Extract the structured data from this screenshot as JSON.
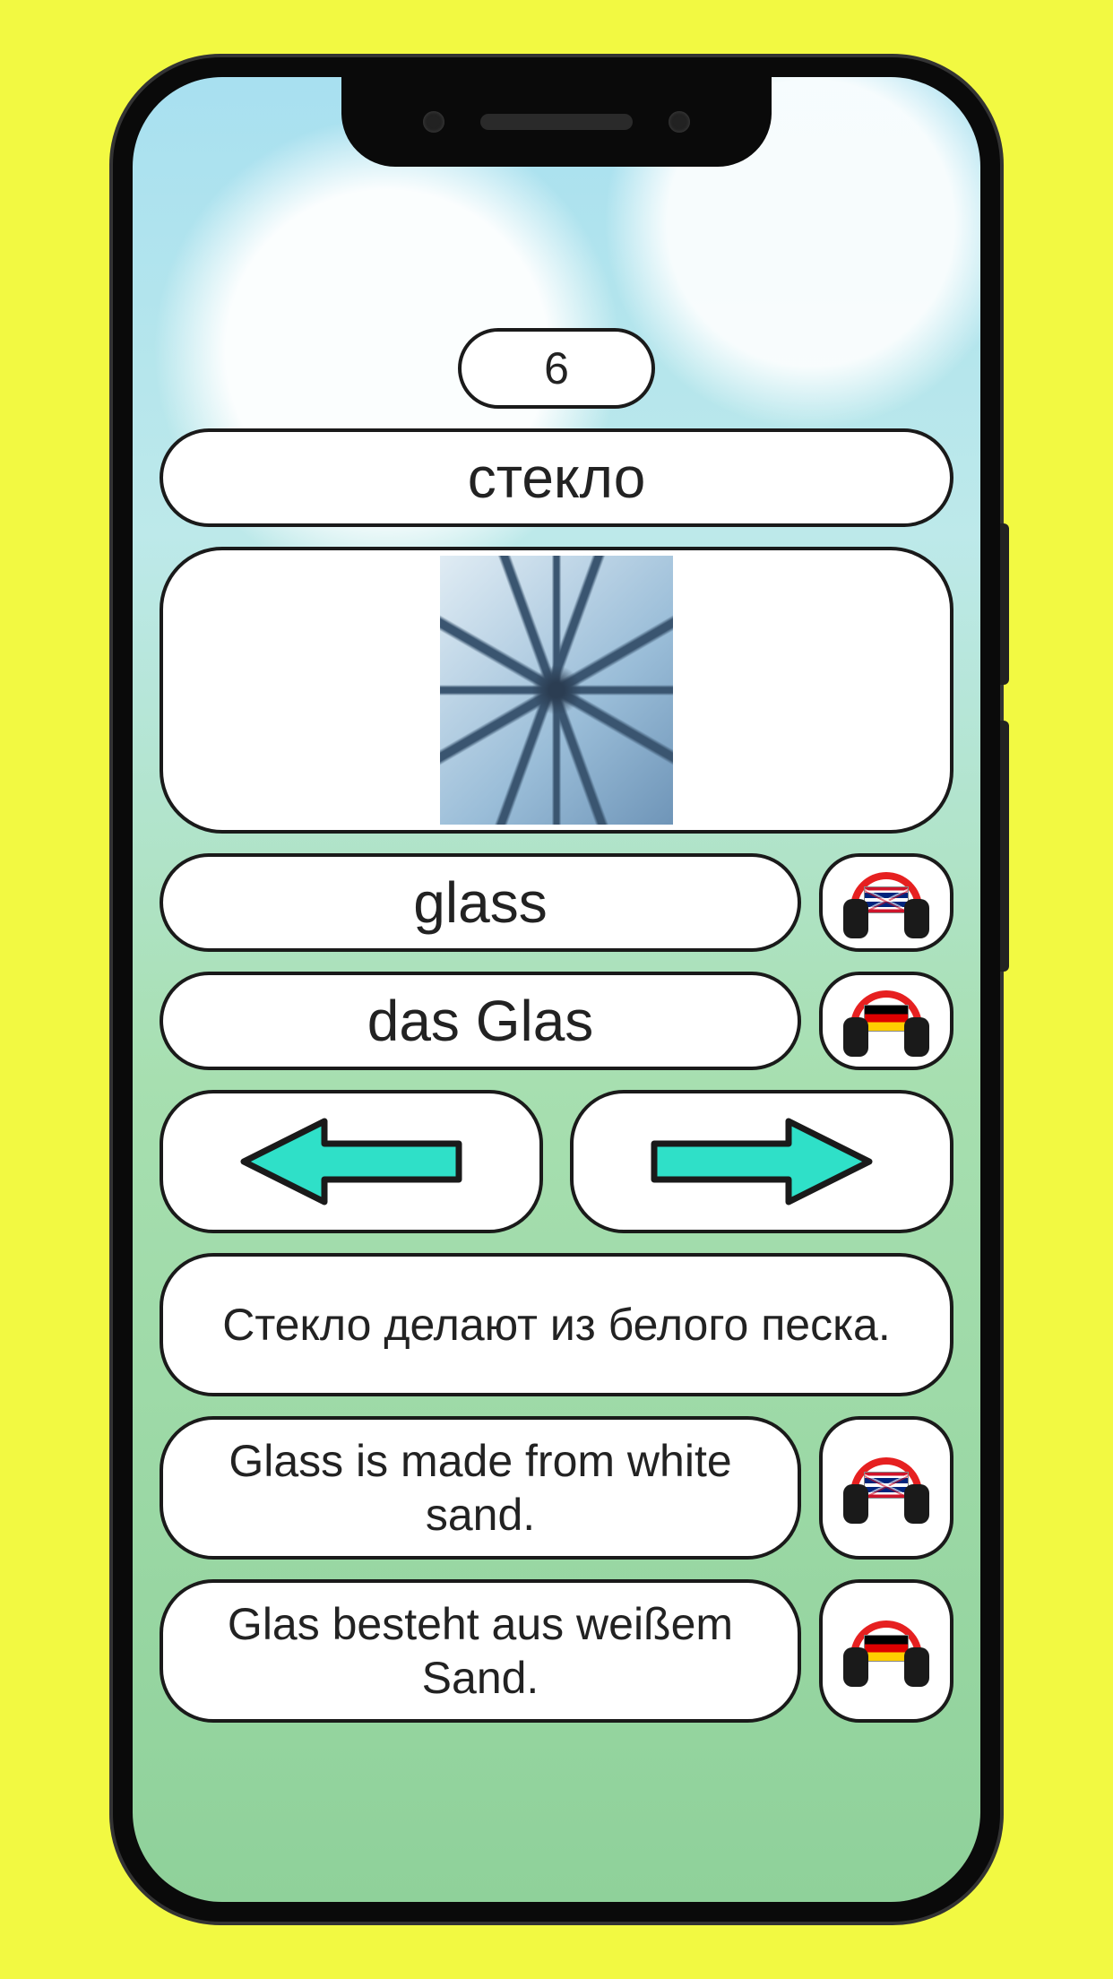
{
  "card": {
    "number": "6",
    "word_native": "стекло",
    "image_alt": "broken glass",
    "word_en": "glass",
    "word_de": "das Glas",
    "sentence_native": "Стекло делают из белого песка.",
    "sentence_en": "Glass is made from white sand.",
    "sentence_de": "Glas besteht aus weißem Sand."
  },
  "audio": {
    "en_icon": "headphones-uk",
    "de_icon": "headphones-de"
  },
  "nav": {
    "prev": "previous",
    "next": "next"
  }
}
